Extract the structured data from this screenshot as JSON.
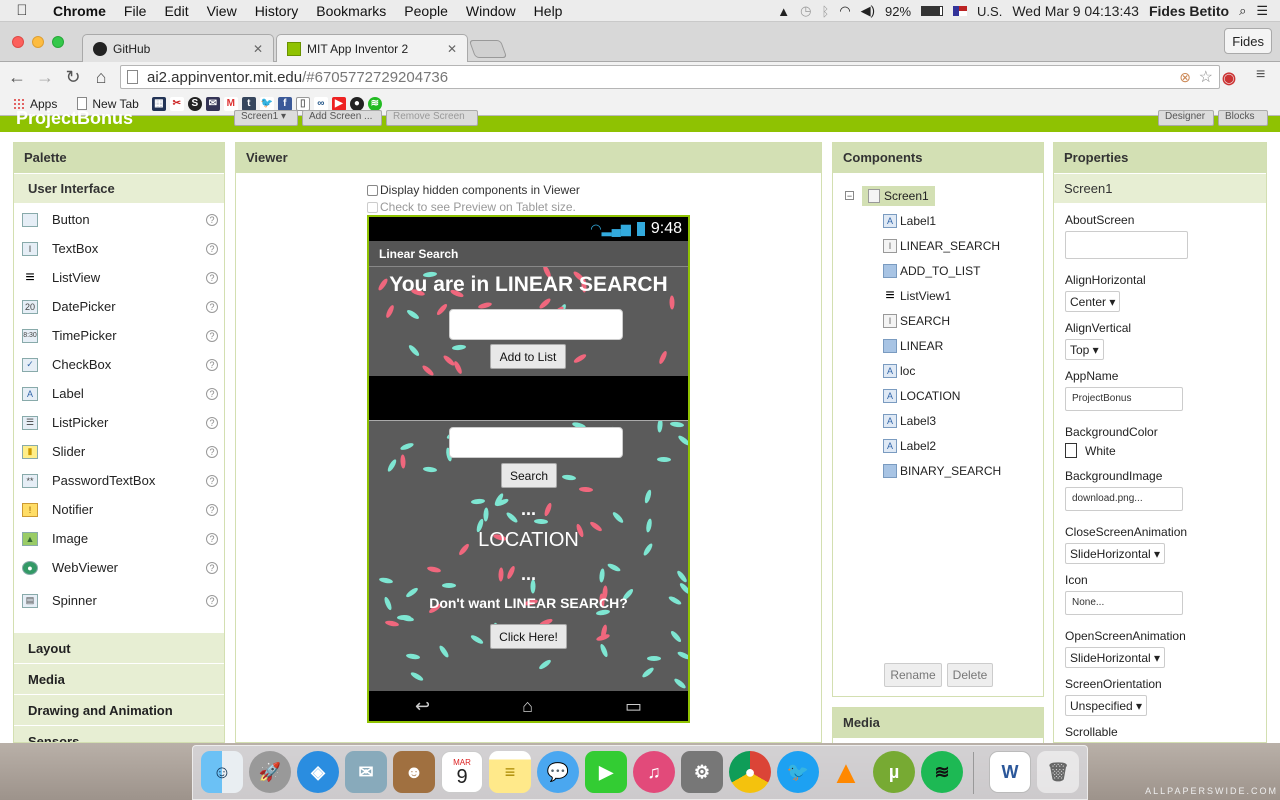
{
  "menubar": {
    "app": "Chrome",
    "items": [
      "File",
      "Edit",
      "View",
      "History",
      "Bookmarks",
      "People",
      "Window",
      "Help"
    ],
    "battery": "92%",
    "input_source": "U.S.",
    "datetime": "Wed Mar 9  04:13:43",
    "user": "Fides Betito"
  },
  "browser": {
    "tabs": [
      {
        "title": "GitHub",
        "active": false
      },
      {
        "title": "MIT App Inventor 2",
        "active": true
      }
    ],
    "profile": "Fides",
    "url_host": "ai2.appinventor.mit.edu",
    "url_path": "/#6705772729204736",
    "bookmarks": [
      {
        "label": "Apps",
        "icon": "apps-grid-icon"
      },
      {
        "label": "New Tab",
        "icon": "page-icon"
      }
    ]
  },
  "app": {
    "project_name": "ProjectBonus",
    "toolbar_buttons": [
      "Screen1 ▾",
      "Add Screen ...",
      "Remove Screen"
    ],
    "right_buttons": [
      "Designer",
      "Blocks"
    ]
  },
  "palette": {
    "title": "Palette",
    "section": "User Interface",
    "items": [
      {
        "label": "Button",
        "icon": "button-icon",
        "glyph": ""
      },
      {
        "label": "TextBox",
        "icon": "textbox-icon",
        "glyph": "I"
      },
      {
        "label": "ListView",
        "icon": "listview-icon",
        "glyph": "≡"
      },
      {
        "label": "DatePicker",
        "icon": "datepicker-icon",
        "glyph": "20"
      },
      {
        "label": "TimePicker",
        "icon": "timepicker-icon",
        "glyph": "8:30"
      },
      {
        "label": "CheckBox",
        "icon": "checkbox-icon",
        "glyph": "✓"
      },
      {
        "label": "Label",
        "icon": "label-icon",
        "glyph": "A"
      },
      {
        "label": "ListPicker",
        "icon": "listpicker-icon",
        "glyph": "☰"
      },
      {
        "label": "Slider",
        "icon": "slider-icon",
        "glyph": "▮"
      },
      {
        "label": "PasswordTextBox",
        "icon": "password-icon",
        "glyph": "**"
      },
      {
        "label": "Notifier",
        "icon": "notifier-icon",
        "glyph": "!"
      },
      {
        "label": "Image",
        "icon": "image-icon",
        "glyph": "▲"
      },
      {
        "label": "WebViewer",
        "icon": "webviewer-icon",
        "glyph": "●"
      },
      {
        "label": "Spinner",
        "icon": "spinner-icon",
        "glyph": "▤"
      }
    ],
    "help_glyph": "?",
    "categories": [
      "Layout",
      "Media",
      "Drawing and Animation",
      "Sensors"
    ]
  },
  "viewer": {
    "title": "Viewer",
    "hidden_checkbox_label": "Display hidden components in Viewer",
    "tablet_checkbox_label": "Check to see Preview on Tablet size.",
    "phone": {
      "time": "9:48",
      "screen_title": "Linear Search",
      "heading": "You are in LINEAR SEARCH",
      "add_button": "Add to List",
      "search_button": "Search",
      "dots1": "...",
      "location_text": "LOCATION",
      "dots2": "...",
      "question": "Don't want LINEAR SEARCH?",
      "click_button": "Click Here!"
    }
  },
  "components": {
    "title": "Components",
    "root": "Screen1",
    "children": [
      {
        "label": "Label1",
        "icon": "label-component-icon",
        "glyph": "A"
      },
      {
        "label": "LINEAR_SEARCH",
        "icon": "textbox-component-icon",
        "glyph": "I"
      },
      {
        "label": "ADD_TO_LIST",
        "icon": "button-component-icon",
        "glyph": ""
      },
      {
        "label": "ListView1",
        "icon": "listview-component-icon",
        "glyph": "≡"
      },
      {
        "label": "SEARCH",
        "icon": "textbox-component-icon",
        "glyph": "I"
      },
      {
        "label": "LINEAR",
        "icon": "button-component-icon",
        "glyph": ""
      },
      {
        "label": "loc",
        "icon": "label-component-icon",
        "glyph": "A"
      },
      {
        "label": "LOCATION",
        "icon": "label-component-icon",
        "glyph": "A"
      },
      {
        "label": "Label3",
        "icon": "label-component-icon",
        "glyph": "A"
      },
      {
        "label": "Label2",
        "icon": "label-component-icon",
        "glyph": "A"
      },
      {
        "label": "BINARY_SEARCH",
        "icon": "button-component-icon",
        "glyph": ""
      }
    ],
    "rename": "Rename",
    "delete": "Delete",
    "media_title": "Media"
  },
  "properties": {
    "title": "Properties",
    "component": "Screen1",
    "about_label": "AboutScreen",
    "about_value": "",
    "align_h_label": "AlignHorizontal",
    "align_h_value": "Center ▾",
    "align_v_label": "AlignVertical",
    "align_v_value": "Top ▾",
    "appname_label": "AppName",
    "appname_value": "ProjectBonus",
    "bgcolor_label": "BackgroundColor",
    "bgcolor_value": "White",
    "bgimage_label": "BackgroundImage",
    "bgimage_value": "download.png...",
    "close_anim_label": "CloseScreenAnimation",
    "close_anim_value": "SlideHorizontal ▾",
    "icon_label": "Icon",
    "icon_value": "None...",
    "open_anim_label": "OpenScreenAnimation",
    "open_anim_value": "SlideHorizontal ▾",
    "orientation_label": "ScreenOrientation",
    "orientation_value": "Unspecified ▾",
    "scrollable_label": "Scrollable"
  },
  "dock": {
    "calendar_month": "MAR",
    "calendar_day": "9",
    "items": [
      "finder-icon",
      "launchpad-icon",
      "safari-icon",
      "mail-icon",
      "contacts-icon",
      "calendar-icon",
      "notes-icon",
      "messages-icon",
      "facetime-icon",
      "itunes-icon",
      "system-preferences-icon",
      "chrome-icon",
      "twitter-icon",
      "vlc-icon",
      "utorrent-icon",
      "spotify-icon",
      "word-document-icon",
      "trash-icon"
    ]
  },
  "watermark": "ALLPAPERSWIDE.COM",
  "colors": {
    "appinventor_green": "#8fc202",
    "panel_header": "#d3e0b4",
    "phone_bg": "#5b5b5b",
    "leaf_pink": "#f0677d",
    "leaf_mint": "#7ee6d2"
  }
}
